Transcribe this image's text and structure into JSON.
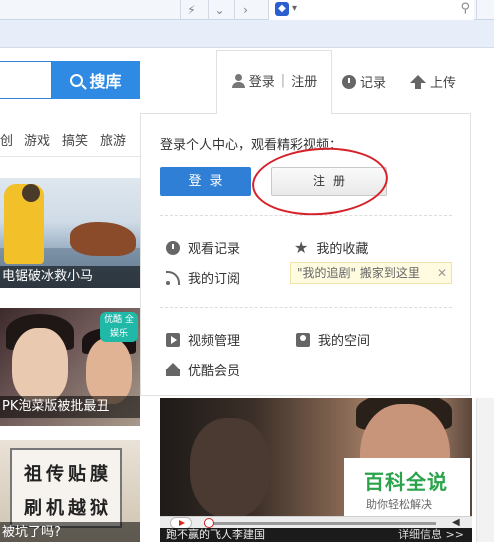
{
  "colors": {
    "accent": "#2e8ae3",
    "annotation": "#d6202a",
    "watermark": "#2aa34a"
  },
  "header": {
    "search_button": "搜库",
    "login_tab": {
      "login": "登录",
      "separator": "|",
      "register": "注册"
    },
    "history": "记录",
    "upload": "上传"
  },
  "categories": [
    "创",
    "游戏",
    "搞笑",
    "旅游"
  ],
  "feed": [
    {
      "caption": "电锯破冰救小马"
    },
    {
      "caption": "PK泡菜版被批最丑",
      "badge": "优酷 全娱乐"
    },
    {
      "caption": "被坑了吗?",
      "sign_lines": [
        "祖传贴膜",
        "刷机越狱"
      ]
    }
  ],
  "panel": {
    "title": "登录个人中心，观看精彩视频：",
    "login_button": "登录",
    "register_button": "注册",
    "items": {
      "history": "观看记录",
      "favorites": "我的收藏",
      "subscriptions": "我的订阅",
      "video_manage": "视频管理",
      "my_space": "我的空间",
      "vip": "优酷会员"
    },
    "tooltip": "\"我的追剧\" 搬家到这里",
    "tooltip_close": "✕"
  },
  "video": {
    "caption": "跑不赢的飞人李建国",
    "more": "详细信息 >>"
  },
  "watermark": {
    "title": "百科全说",
    "subtitle": "助你轻松解决"
  }
}
